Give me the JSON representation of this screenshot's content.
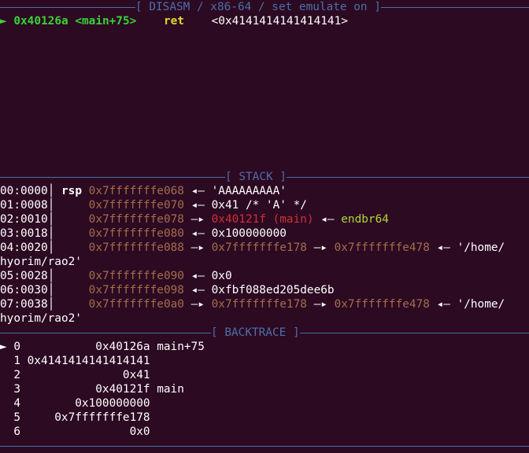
{
  "disasm": {
    "header": "[ DISASM / x86-64 / set emulate on ]",
    "current": {
      "marker": "►",
      "address": "0x40126a",
      "symbol": "<main+75>",
      "mnemonic": "ret",
      "operand": "<0x4141414141414141>"
    }
  },
  "stack": {
    "header": "[ STACK ]",
    "rows": [
      {
        "index": "00:0000",
        "reg": "rsp",
        "addr": "0x7fffffffe068",
        "parts": [
          {
            "arrow": "◂—",
            "text": "'AAAAAAAAA'",
            "color": "white"
          }
        ]
      },
      {
        "index": "01:0008",
        "reg": "",
        "addr": "0x7fffffffe070",
        "parts": [
          {
            "arrow": "◂—",
            "text": "0x41 /* 'A' */",
            "color": "white"
          }
        ]
      },
      {
        "index": "02:0010",
        "reg": "",
        "addr": "0x7fffffffe078",
        "parts": [
          {
            "arrow": "—▸",
            "text": "0x40121f (main)",
            "color": "red"
          },
          {
            "arrow": "◂—",
            "text": "endbr64",
            "color": "lime"
          }
        ]
      },
      {
        "index": "03:0018",
        "reg": "",
        "addr": "0x7fffffffe080",
        "parts": [
          {
            "arrow": "◂—",
            "text": "0x100000000",
            "color": "white"
          }
        ]
      },
      {
        "index": "04:0020",
        "reg": "",
        "addr": "0x7fffffffe088",
        "parts": [
          {
            "arrow": "—▸",
            "text": "0x7fffffffe178",
            "color": "brown"
          },
          {
            "arrow": "—▸",
            "text": "0x7fffffffe478",
            "color": "brown"
          },
          {
            "arrow": "◂—",
            "text": "'/home/",
            "color": "white"
          }
        ],
        "wrap": "hyorim/rao2'"
      },
      {
        "index": "05:0028",
        "reg": "",
        "addr": "0x7fffffffe090",
        "parts": [
          {
            "arrow": "◂—",
            "text": "0x0",
            "color": "white"
          }
        ]
      },
      {
        "index": "06:0030",
        "reg": "",
        "addr": "0x7fffffffe098",
        "parts": [
          {
            "arrow": "◂—",
            "text": "0xfbf088ed205dee6b",
            "color": "white"
          }
        ]
      },
      {
        "index": "07:0038",
        "reg": "",
        "addr": "0x7fffffffe0a0",
        "parts": [
          {
            "arrow": "—▸",
            "text": "0x7fffffffe178",
            "color": "brown"
          },
          {
            "arrow": "—▸",
            "text": "0x7fffffffe478",
            "color": "brown"
          },
          {
            "arrow": "◂—",
            "text": "'/home/",
            "color": "white"
          }
        ],
        "wrap": "hyorim/rao2'"
      }
    ]
  },
  "backtrace": {
    "header": "[ BACKTRACE ]",
    "marker": "►",
    "frames": [
      {
        "num": "0",
        "addr": "0x40126a",
        "sym": "main+75"
      },
      {
        "num": "1",
        "addr": "0x4141414141414141",
        "sym": ""
      },
      {
        "num": "2",
        "addr": "0x41",
        "sym": ""
      },
      {
        "num": "3",
        "addr": "0x40121f",
        "sym": "main"
      },
      {
        "num": "4",
        "addr": "0x100000000",
        "sym": ""
      },
      {
        "num": "5",
        "addr": "0x7fffffffe178",
        "sym": ""
      },
      {
        "num": "6",
        "addr": "0x0",
        "sym": ""
      }
    ]
  },
  "colors": {
    "background": "#2c0a22",
    "separator": "#4c6fa8",
    "current_green": "#3ad13a",
    "mnemonic_yellow": "#e2d62d",
    "stack_address": "#a46d4b",
    "code_pointer_red": "#cf3039",
    "instruction_lime": "#b0d53a"
  }
}
